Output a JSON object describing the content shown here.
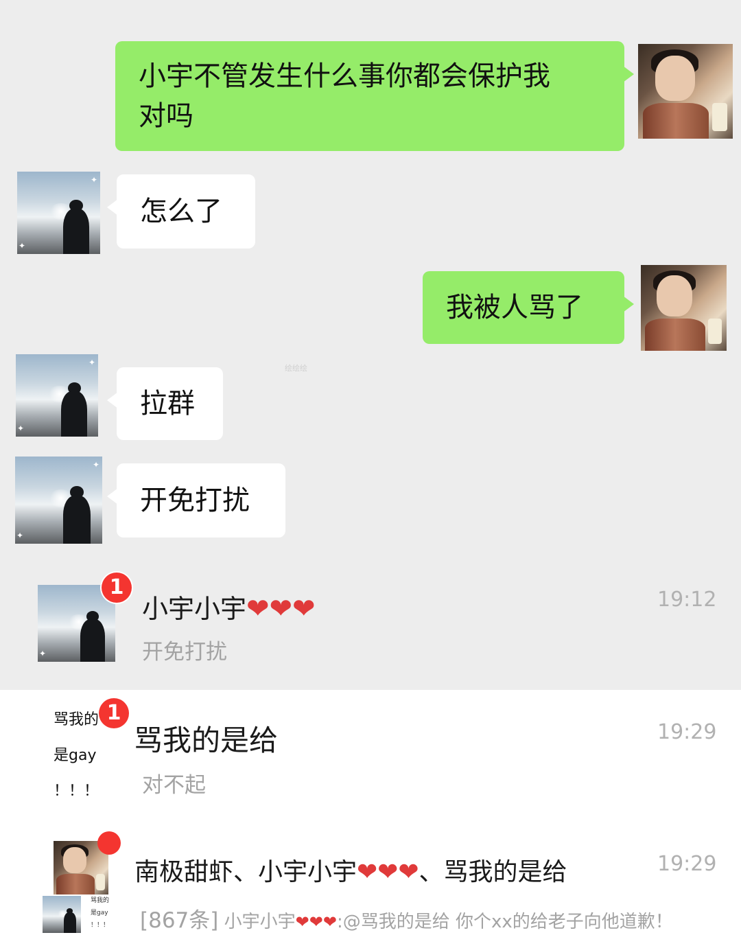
{
  "messages": [
    {
      "side": "me",
      "text_line1": "小宇不管发生什么事你都会保护我",
      "text_line2": "对吗"
    },
    {
      "side": "them",
      "text": "怎么了"
    },
    {
      "side": "me",
      "text": "我被人骂了"
    },
    {
      "side": "them",
      "text": "拉群"
    },
    {
      "side": "them",
      "text": "开免打扰"
    }
  ],
  "watermark": "绘绘绘",
  "conversations": [
    {
      "name": "小宇小宇",
      "hearts": "❤❤❤",
      "preview": "开免打扰",
      "time": "19:12",
      "badge": "1"
    },
    {
      "name": "骂我的是给",
      "avatar_text": [
        "骂我的",
        "是gay",
        "！！！"
      ],
      "preview": "对不起",
      "time": "19:29",
      "badge": "1"
    },
    {
      "name_part1": "南极甜虾、小宇小宇",
      "hearts": "❤❤❤",
      "name_part2": "、骂我的是给",
      "time": "19:29",
      "preview_count": "[867条]",
      "preview_sender": "小宇小宇",
      "preview_hearts": "❤❤❤",
      "preview_text": ":@骂我的是给 你个xx的给老子向他道歉！",
      "mini_avatar_text": [
        "骂我的",
        "是gay",
        "！！！"
      ]
    }
  ],
  "colors": {
    "my_bubble": "#95ec69",
    "their_bubble": "#ffffff",
    "badge": "#f43530",
    "chat_bg": "#ededed"
  },
  "icons": {
    "heart": "heart-icon",
    "silhouette": "silhouette-avatar",
    "photo": "photo-avatar"
  }
}
